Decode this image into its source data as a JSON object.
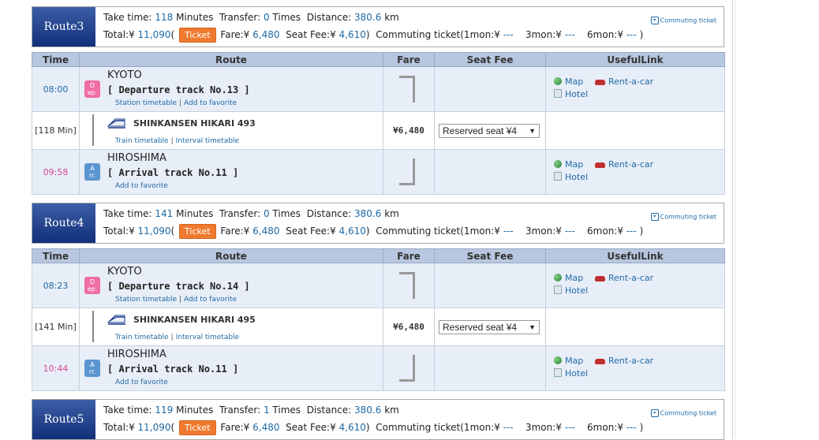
{
  "labels": {
    "take_time": "Take time:",
    "minutes": "Minutes",
    "transfer": "Transfer:",
    "times": "Times",
    "distance": "Distance:",
    "km": "km",
    "total": "Total:¥",
    "ticket_btn": "Ticket",
    "fare": "Fare:¥",
    "seat_fee": "Seat Fee:¥",
    "commuting": "Commuting ticket(1mon:¥",
    "mon3": "3mon:¥",
    "mon6": "6mon:¥",
    "dashes": "---",
    "close_paren": ")",
    "open_paren": "(",
    "close_paren_fare": ")",
    "commuting_link": "Commuting ticket",
    "th_time": "Time",
    "th_route": "Route",
    "th_fare": "Fare",
    "th_seat": "Seat Fee",
    "th_useful": "UsefulLink",
    "station_timetable": "Station timetable",
    "add_favorite": "Add to favorite",
    "train_timetable": "Train timetable",
    "interval_timetable": "Interval timetable",
    "map": "Map",
    "rent_a_car": "Rent-a-car",
    "hotel": "Hotel",
    "dep_icon_top": "D",
    "dep_icon_bottom": "ep.",
    "arr_icon_top": "A",
    "arr_icon_bottom": "rr.",
    "link_sep": "|"
  },
  "routes": [
    {
      "name": "Route3",
      "take_time": "118",
      "transfer": "0",
      "distance": "380.6",
      "total": "11,090",
      "fare": "6,480",
      "seat_fee": "4,610",
      "dep_time": "08:00",
      "dep_station": "KYOTO",
      "dep_track": "[ Departure track No.13 ]",
      "duration": "[118 Min]",
      "train": "SHINKANSEN HIKARI 493",
      "train_fare": "¥6,480",
      "seat_select": "Reserved seat ¥4",
      "arr_time": "09:58",
      "arr_station": "HIROSHIMA",
      "arr_track": "[ Arrival track No.11 ]"
    },
    {
      "name": "Route4",
      "take_time": "141",
      "transfer": "0",
      "distance": "380.6",
      "total": "11,090",
      "fare": "6,480",
      "seat_fee": "4,610",
      "dep_time": "08:23",
      "dep_station": "KYOTO",
      "dep_track": "[ Departure track No.14 ]",
      "duration": "[141 Min]",
      "train": "SHINKANSEN HIKARI 495",
      "train_fare": "¥6,480",
      "seat_select": "Reserved seat ¥4",
      "arr_time": "10:44",
      "arr_station": "HIROSHIMA",
      "arr_track": "[ Arrival track No.11 ]"
    },
    {
      "name": "Route5",
      "take_time": "119",
      "transfer": "1",
      "distance": "380.6",
      "total": "11,090",
      "fare": "6,480",
      "seat_fee": "4,610"
    }
  ],
  "colors": {
    "badge": "#12307a",
    "ticket": "#ef7a2f",
    "link": "#1f6aa5",
    "arrival_time": "#d44a8b",
    "header_bg": "#b7c7df"
  }
}
